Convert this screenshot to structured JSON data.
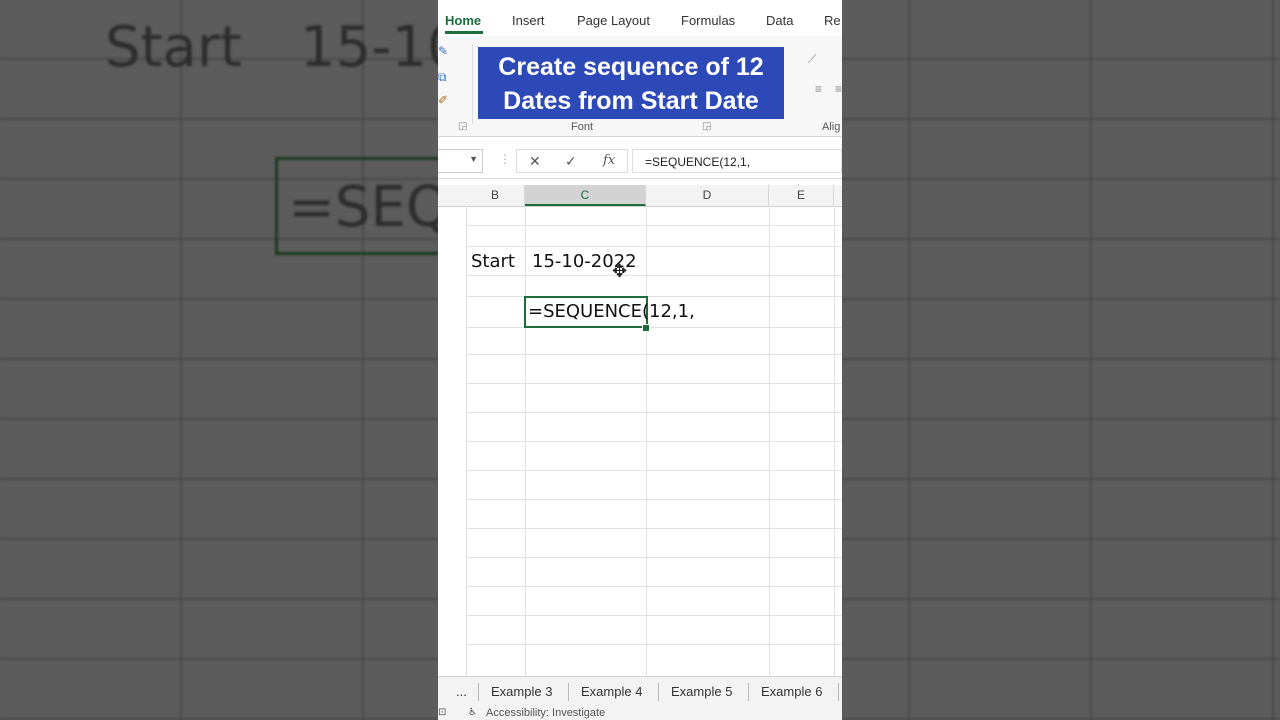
{
  "ribbon": {
    "tabs": [
      "Home",
      "Insert",
      "Page Layout",
      "Formulas",
      "Data",
      "Re"
    ],
    "group_font_label": "Font",
    "group_align_label": "Alig"
  },
  "title_overlay": {
    "line1": "Create sequence of 12",
    "line2": "Dates from Start Date"
  },
  "formula_bar": {
    "cancel_icon": "✕",
    "enter_icon": "✓",
    "fx_icon": "fx",
    "content": "=SEQUENCE(12,1,"
  },
  "columns": [
    "B",
    "C",
    "D",
    "E"
  ],
  "cells": {
    "b_label": "Start",
    "c_date": "15-10-2022",
    "active_formula": "=SEQUENCE(12,1,"
  },
  "sheet_tabs": {
    "more": "...",
    "tabs": [
      "Example 3",
      "Example 4",
      "Example 5",
      "Example 6"
    ]
  },
  "status_bar": {
    "accessibility": "Accessibility: Investigate"
  },
  "background": {
    "start_text": "Start",
    "date_text": "15-10",
    "formula_text": "=SEQ"
  },
  "colors": {
    "accent_green": "#1e6b3c",
    "overlay_blue": "#2d49b8"
  }
}
